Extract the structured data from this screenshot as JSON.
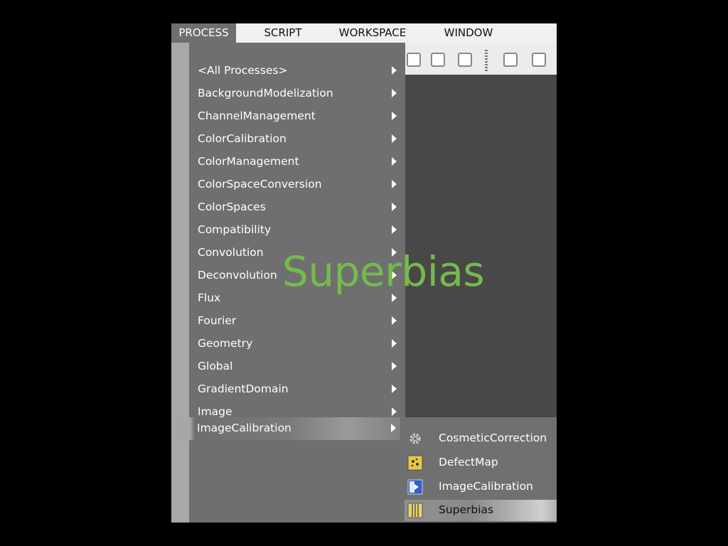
{
  "menubar": {
    "items": [
      {
        "label": "PROCESS",
        "active": true
      },
      {
        "label": "SCRIPT",
        "active": false
      },
      {
        "label": "WORKSPACE",
        "active": false
      },
      {
        "label": "WINDOW",
        "active": false
      }
    ]
  },
  "process_menu": {
    "items": [
      {
        "label": "<All Processes>",
        "has_submenu": true
      },
      {
        "label": "BackgroundModelization",
        "has_submenu": true
      },
      {
        "label": "ChannelManagement",
        "has_submenu": true
      },
      {
        "label": "ColorCalibration",
        "has_submenu": true
      },
      {
        "label": "ColorManagement",
        "has_submenu": true
      },
      {
        "label": "ColorSpaceConversion",
        "has_submenu": true
      },
      {
        "label": "ColorSpaces",
        "has_submenu": true
      },
      {
        "label": "Compatibility",
        "has_submenu": true
      },
      {
        "label": "Convolution",
        "has_submenu": true
      },
      {
        "label": "Deconvolution",
        "has_submenu": true
      },
      {
        "label": "Flux",
        "has_submenu": true
      },
      {
        "label": "Fourier",
        "has_submenu": true
      },
      {
        "label": "Geometry",
        "has_submenu": true
      },
      {
        "label": "Global",
        "has_submenu": true
      },
      {
        "label": "GradientDomain",
        "has_submenu": true
      },
      {
        "label": "Image",
        "has_submenu": true
      },
      {
        "label": "ImageCalibration",
        "has_submenu": true,
        "highlighted": true
      }
    ]
  },
  "submenu": {
    "items": [
      {
        "label": "CosmeticCorrection",
        "icon": "gear-icon"
      },
      {
        "label": "DefectMap",
        "icon": "defect-map-icon"
      },
      {
        "label": "ImageCalibration",
        "icon": "image-calibration-icon"
      },
      {
        "label": "Superbias",
        "icon": "superbias-icon",
        "selected": true
      }
    ]
  },
  "caption": {
    "text": "Superbias",
    "color": "#74bb4c"
  },
  "colors": {
    "menu_bg": "#6f6f6f",
    "workspace_bg": "#484848",
    "menubar_bg": "#f0f0f0"
  }
}
